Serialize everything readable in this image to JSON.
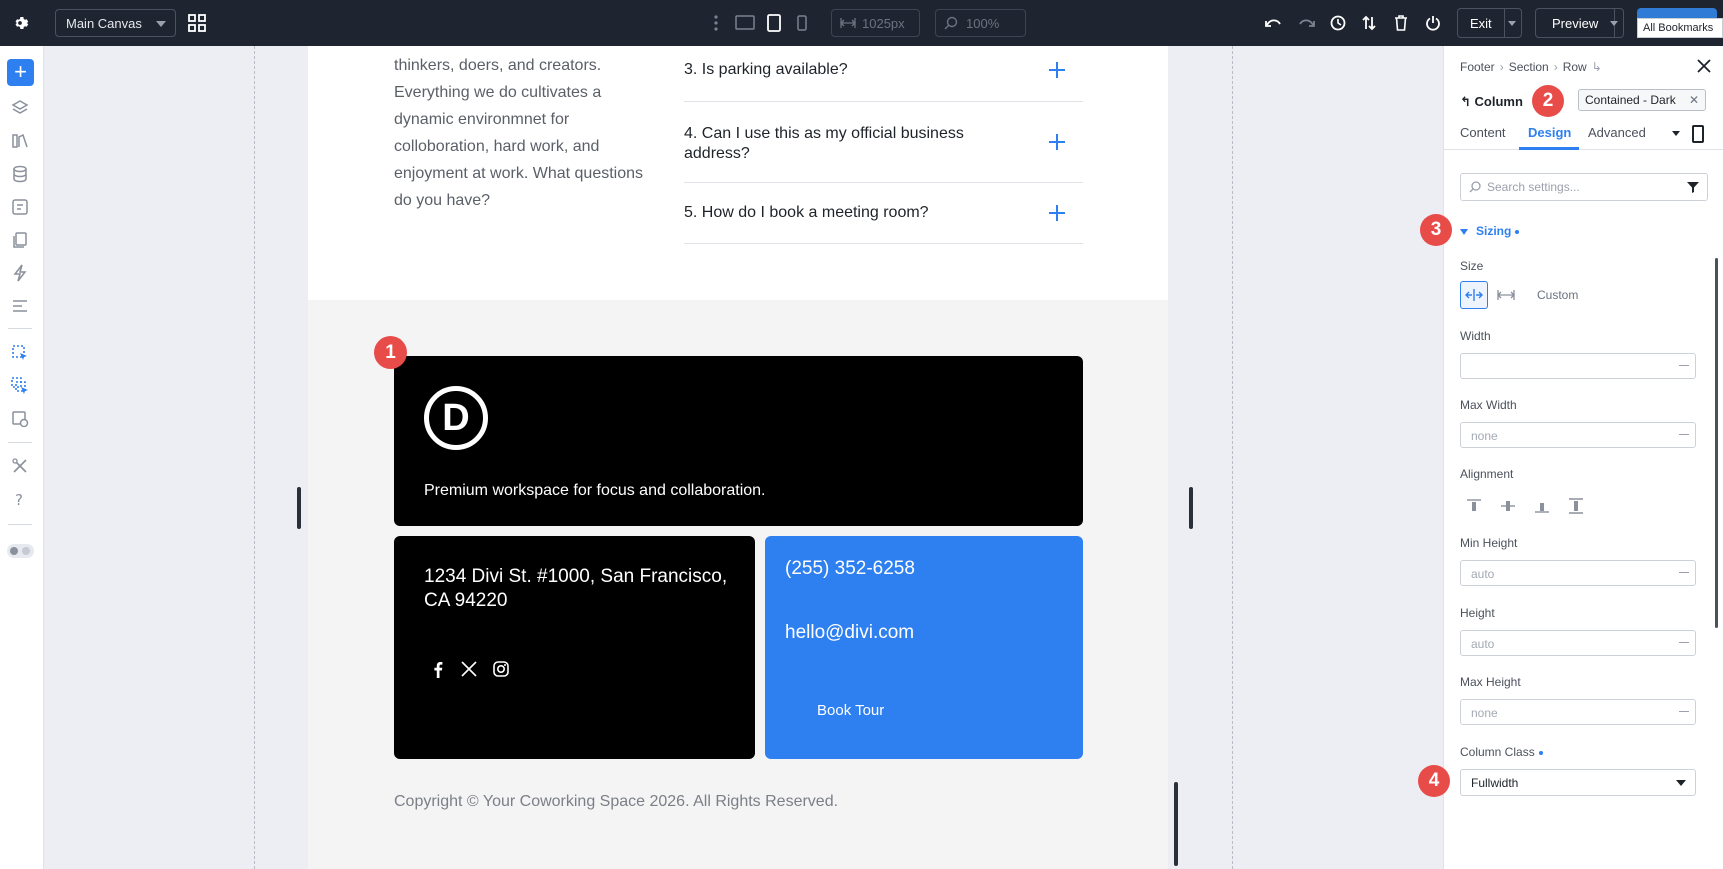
{
  "topbar": {
    "canvas_name": "Main Canvas",
    "width_value": "1025px",
    "zoom_value": "100%",
    "exit_label": "Exit",
    "preview_label": "Preview",
    "tooltip": "All Bookmarks"
  },
  "page": {
    "intro_text": "thinkers, doers, and creators. Everything we do cultivates a dynamic environmnet for colloboration, hard work, and enjoyment at work. What questions do you have?",
    "faq": [
      {
        "question": "3. Is parking available?"
      },
      {
        "question": "4. Can I use this as my official business address?"
      },
      {
        "question": "5. How do I book a meeting room?"
      }
    ],
    "footer": {
      "logo_letter": "D",
      "tagline": "Premium workspace for focus and collaboration.",
      "address": "1234 Divi St. #1000, San Francisco, CA 94220",
      "phone": "(255) 352-6258",
      "email": "hello@divi.com",
      "cta_label": "Book Tour",
      "copyright": "Copyright © Your Coworking Space 2026. All Rights Reserved."
    }
  },
  "badges": {
    "b1": "1",
    "b2": "2",
    "b3": "3",
    "b4": "4"
  },
  "panel": {
    "breadcrumb": [
      "Footer",
      "Section",
      "Row"
    ],
    "element_title": "Column",
    "preset_label": "Contained - Dark",
    "tabs": {
      "content": "Content",
      "design": "Design",
      "advanced": "Advanced"
    },
    "active_tab": "Design",
    "search_placeholder": "Search settings...",
    "group_title": "Sizing",
    "size_label": "Size",
    "size_custom": "Custom",
    "width_label": "Width",
    "width_value": "",
    "max_width_label": "Max Width",
    "max_width_value": "none",
    "alignment_label": "Alignment",
    "min_height_label": "Min Height",
    "min_height_value": "auto",
    "height_label": "Height",
    "height_value": "auto",
    "max_height_label": "Max Height",
    "max_height_value": "none",
    "column_class_label": "Column Class",
    "column_class_value": "Fullwidth"
  },
  "colors": {
    "accent": "#2e7ff0",
    "topbar": "#1f2530",
    "badge": "#e74c49"
  }
}
